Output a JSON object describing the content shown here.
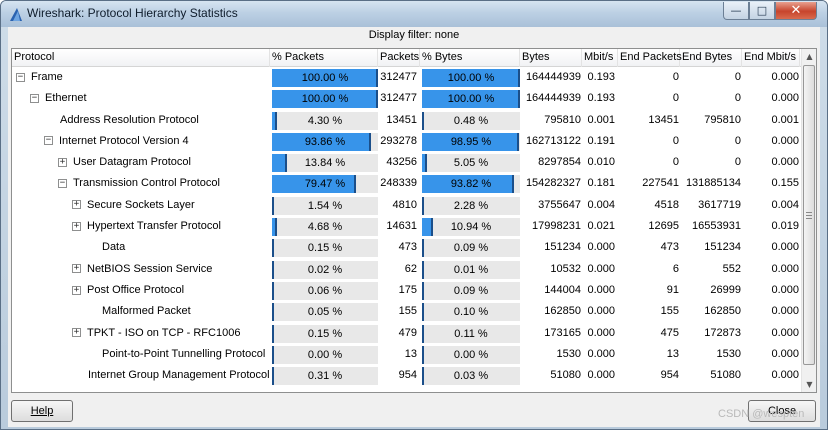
{
  "window": {
    "title": "Wireshark: Protocol Hierarchy Statistics"
  },
  "filter": {
    "text": "Display filter: none"
  },
  "columns": {
    "protocol": "Protocol",
    "pct_packets": "% Packets",
    "packets": "Packets",
    "pct_bytes": "% Bytes",
    "bytes": "Bytes",
    "mbit": "Mbit/s",
    "end_packets": "End Packets",
    "end_bytes": "End Bytes",
    "end_mbit": "End Mbit/s"
  },
  "rows": [
    {
      "name": "Frame",
      "expander": "minus",
      "level": 0,
      "pct_packets": "100.00 %",
      "pct_packets_value": 100.0,
      "packets": "312477",
      "pct_bytes": "100.00 %",
      "pct_bytes_value": 100.0,
      "bytes": "164444939",
      "mbit": "0.193",
      "end_packets": "0",
      "end_bytes": "0",
      "end_mbit": "0.000"
    },
    {
      "name": "Ethernet",
      "expander": "minus",
      "level": 1,
      "pct_packets": "100.00 %",
      "pct_packets_value": 100.0,
      "packets": "312477",
      "pct_bytes": "100.00 %",
      "pct_bytes_value": 100.0,
      "bytes": "164444939",
      "mbit": "0.193",
      "end_packets": "0",
      "end_bytes": "0",
      "end_mbit": "0.000"
    },
    {
      "name": "Address Resolution Protocol",
      "expander": "none",
      "level": 2,
      "pct_packets": "4.30 %",
      "pct_packets_value": 4.3,
      "packets": "13451",
      "pct_bytes": "0.48 %",
      "pct_bytes_value": 0.48,
      "bytes": "795810",
      "mbit": "0.001",
      "end_packets": "13451",
      "end_bytes": "795810",
      "end_mbit": "0.001"
    },
    {
      "name": "Internet Protocol Version 4",
      "expander": "minus",
      "level": 2,
      "pct_packets": "93.86 %",
      "pct_packets_value": 93.86,
      "packets": "293278",
      "pct_bytes": "98.95 %",
      "pct_bytes_value": 98.95,
      "bytes": "162713122",
      "mbit": "0.191",
      "end_packets": "0",
      "end_bytes": "0",
      "end_mbit": "0.000"
    },
    {
      "name": "User Datagram Protocol",
      "expander": "plus",
      "level": 3,
      "pct_packets": "13.84 %",
      "pct_packets_value": 13.84,
      "packets": "43256",
      "pct_bytes": "5.05 %",
      "pct_bytes_value": 5.05,
      "bytes": "8297854",
      "mbit": "0.010",
      "end_packets": "0",
      "end_bytes": "0",
      "end_mbit": "0.000"
    },
    {
      "name": "Transmission Control Protocol",
      "expander": "minus",
      "level": 3,
      "pct_packets": "79.47 %",
      "pct_packets_value": 79.47,
      "packets": "248339",
      "pct_bytes": "93.82 %",
      "pct_bytes_value": 93.82,
      "bytes": "154282327",
      "mbit": "0.181",
      "end_packets": "227541",
      "end_bytes": "131885134",
      "end_mbit": "0.155"
    },
    {
      "name": "Secure Sockets Layer",
      "expander": "plus",
      "level": 4,
      "pct_packets": "1.54 %",
      "pct_packets_value": 1.54,
      "packets": "4810",
      "pct_bytes": "2.28 %",
      "pct_bytes_value": 2.28,
      "bytes": "3755647",
      "mbit": "0.004",
      "end_packets": "4518",
      "end_bytes": "3617719",
      "end_mbit": "0.004"
    },
    {
      "name": "Hypertext Transfer Protocol",
      "expander": "plus",
      "level": 4,
      "pct_packets": "4.68 %",
      "pct_packets_value": 4.68,
      "packets": "14631",
      "pct_bytes": "10.94 %",
      "pct_bytes_value": 10.94,
      "bytes": "17998231",
      "mbit": "0.021",
      "end_packets": "12695",
      "end_bytes": "16553931",
      "end_mbit": "0.019"
    },
    {
      "name": "Data",
      "expander": "none",
      "level": 5,
      "pct_packets": "0.15 %",
      "pct_packets_value": 0.15,
      "packets": "473",
      "pct_bytes": "0.09 %",
      "pct_bytes_value": 0.09,
      "bytes": "151234",
      "mbit": "0.000",
      "end_packets": "473",
      "end_bytes": "151234",
      "end_mbit": "0.000"
    },
    {
      "name": "NetBIOS Session Service",
      "expander": "plus",
      "level": 4,
      "pct_packets": "0.02 %",
      "pct_packets_value": 0.02,
      "packets": "62",
      "pct_bytes": "0.01 %",
      "pct_bytes_value": 0.01,
      "bytes": "10532",
      "mbit": "0.000",
      "end_packets": "6",
      "end_bytes": "552",
      "end_mbit": "0.000"
    },
    {
      "name": "Post Office Protocol",
      "expander": "plus",
      "level": 4,
      "pct_packets": "0.06 %",
      "pct_packets_value": 0.06,
      "packets": "175",
      "pct_bytes": "0.09 %",
      "pct_bytes_value": 0.09,
      "bytes": "144004",
      "mbit": "0.000",
      "end_packets": "91",
      "end_bytes": "26999",
      "end_mbit": "0.000"
    },
    {
      "name": "Malformed Packet",
      "expander": "none",
      "level": 5,
      "pct_packets": "0.05 %",
      "pct_packets_value": 0.05,
      "packets": "155",
      "pct_bytes": "0.10 %",
      "pct_bytes_value": 0.1,
      "bytes": "162850",
      "mbit": "0.000",
      "end_packets": "155",
      "end_bytes": "162850",
      "end_mbit": "0.000"
    },
    {
      "name": "TPKT - ISO on TCP - RFC1006",
      "expander": "plus",
      "level": 4,
      "pct_packets": "0.15 %",
      "pct_packets_value": 0.15,
      "packets": "479",
      "pct_bytes": "0.11 %",
      "pct_bytes_value": 0.11,
      "bytes": "173165",
      "mbit": "0.000",
      "end_packets": "475",
      "end_bytes": "172873",
      "end_mbit": "0.000"
    },
    {
      "name": "Point-to-Point Tunnelling Protocol",
      "expander": "none",
      "level": 5,
      "pct_packets": "0.00 %",
      "pct_packets_value": 0.0,
      "packets": "13",
      "pct_bytes": "0.00 %",
      "pct_bytes_value": 0.0,
      "bytes": "1530",
      "mbit": "0.000",
      "end_packets": "13",
      "end_bytes": "1530",
      "end_mbit": "0.000"
    },
    {
      "name": "Internet Group Management Protocol",
      "expander": "none",
      "level": 4,
      "pct_packets": "0.31 %",
      "pct_packets_value": 0.31,
      "packets": "954",
      "pct_bytes": "0.03 %",
      "pct_bytes_value": 0.03,
      "bytes": "51080",
      "mbit": "0.000",
      "end_packets": "954",
      "end_bytes": "51080",
      "end_mbit": "0.000"
    }
  ],
  "buttons": {
    "help": "Help",
    "close": "Close"
  },
  "watermark": "CSDN @wespten",
  "colors": {
    "bar_fill": "#3794ea",
    "bar_bg": "#e8e8e8"
  },
  "icons": {
    "app": "wireshark-fin-icon",
    "minimize": "minimize-icon",
    "maximize": "maximize-icon",
    "close": "close-icon"
  }
}
